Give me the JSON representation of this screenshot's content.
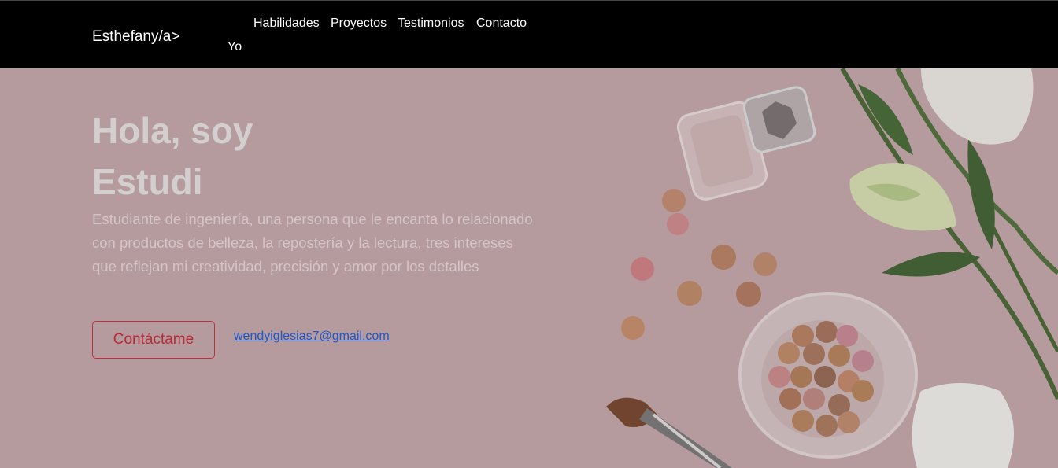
{
  "navbar": {
    "brand": "Esthefany/a>",
    "links": [
      "Yo",
      "Habilidades",
      "Proyectos",
      "Testimonios",
      "Contacto"
    ]
  },
  "hero": {
    "title_line1": "Hola, soy",
    "title_line2": "Estudi",
    "description": "Estudiante de ingeniería, una persona que le encanta lo relacionado con productos de belleza, la repostería y la lectura, tres intereses que reflejan mi creatividad, precisión y amor por los detalles",
    "contact_button": "Contáctame",
    "email": "wendyiglesias7@gmail.com"
  },
  "colors": {
    "navbar_bg": "#000000",
    "hero_bg": "#c5a9ac",
    "accent": "#c0303c",
    "link": "#1f57c8"
  },
  "icons": [
    "perfume-bottle-icon",
    "makeup-beads-icon",
    "makeup-brush-icon",
    "flower-icon"
  ]
}
